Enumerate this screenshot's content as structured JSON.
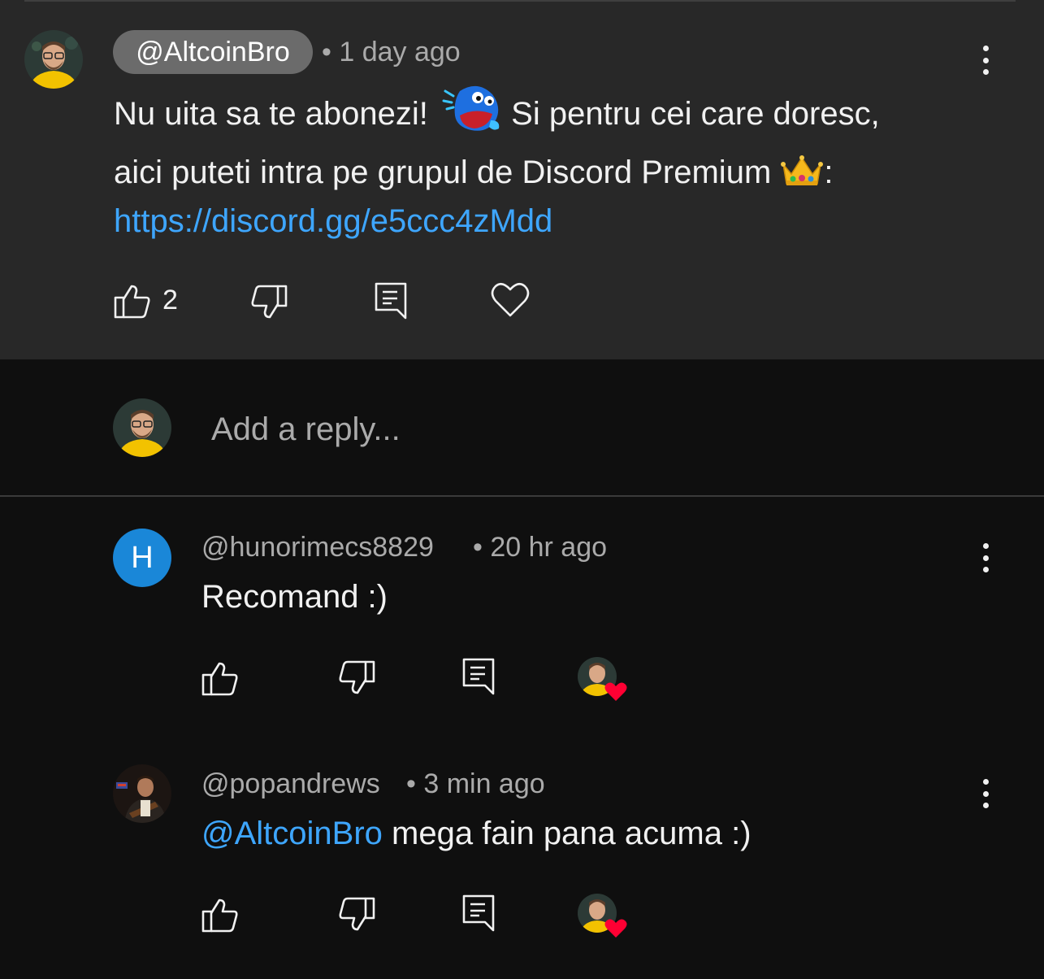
{
  "main_comment": {
    "author": "@AltcoinBro",
    "time": "• 1 day ago",
    "line1_a": "Nu uita sa te abonezi!",
    "line1_b": "Si pentru cei care doresc,",
    "line2": "aici puteti intra pe grupul de Discord Premium",
    "line2_end": ":",
    "link": "https://discord.gg/e5ccc4zMdd",
    "like_count": "2"
  },
  "reply_box": {
    "placeholder": "Add a reply..."
  },
  "replies": [
    {
      "avatar_letter": "H",
      "author": "@hunorimecs8829",
      "time": "• 20 hr ago",
      "text": "Recomand :)"
    },
    {
      "author": "@popandrews",
      "time": "• 3 min ago",
      "mention": "@AltcoinBro",
      "text": " mega fain pana acuma :)"
    }
  ],
  "colors": {
    "link": "#3ea6ff",
    "heart_badge": "#ff0033",
    "letter_avatar_bg": "#1a87d8"
  }
}
